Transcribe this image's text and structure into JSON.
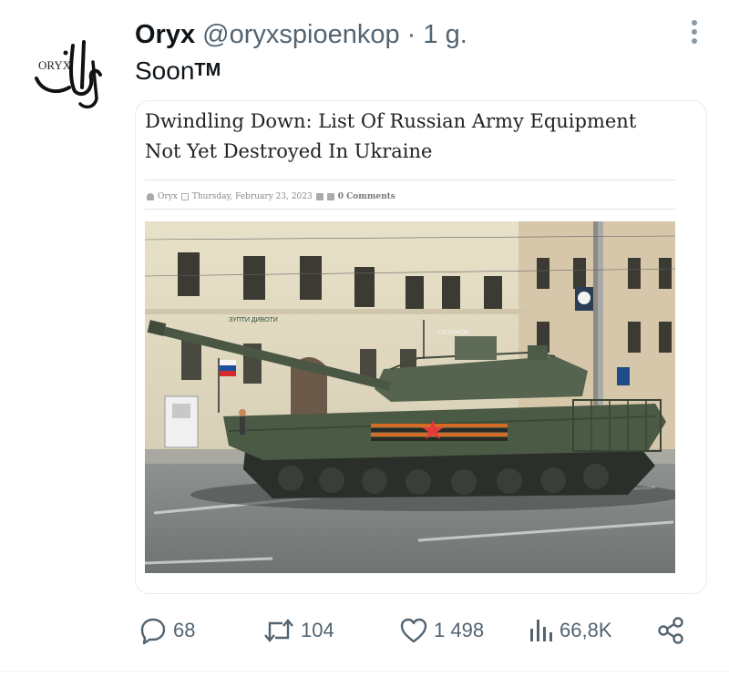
{
  "tweet": {
    "author_name": "Oryx",
    "author_handle": "@oryxspioenkop · 1 g.",
    "avatar_text": "ORYX",
    "text": "Soon",
    "text_tm": "TM"
  },
  "card": {
    "title_line1": "Dwindling Down: List Of Russian Army Equipment",
    "title_line2": "Not Yet Destroyed In Ukraine",
    "meta_author": "Oryx",
    "meta_date": "Thursday, February 23, 2023",
    "meta_comments": "0 Comments",
    "image_sign_1": "ЗУПТИ  ДИВОТИ",
    "image_sign_2": "САХАНОК"
  },
  "actions": {
    "replies": "68",
    "retweets": "104",
    "likes": "1 498",
    "views": "66,8K"
  },
  "colors": {
    "text_primary": "#0f1419",
    "text_secondary": "#536471",
    "card_border": "#e6ecf0",
    "tank_green": "#4b5a45"
  }
}
